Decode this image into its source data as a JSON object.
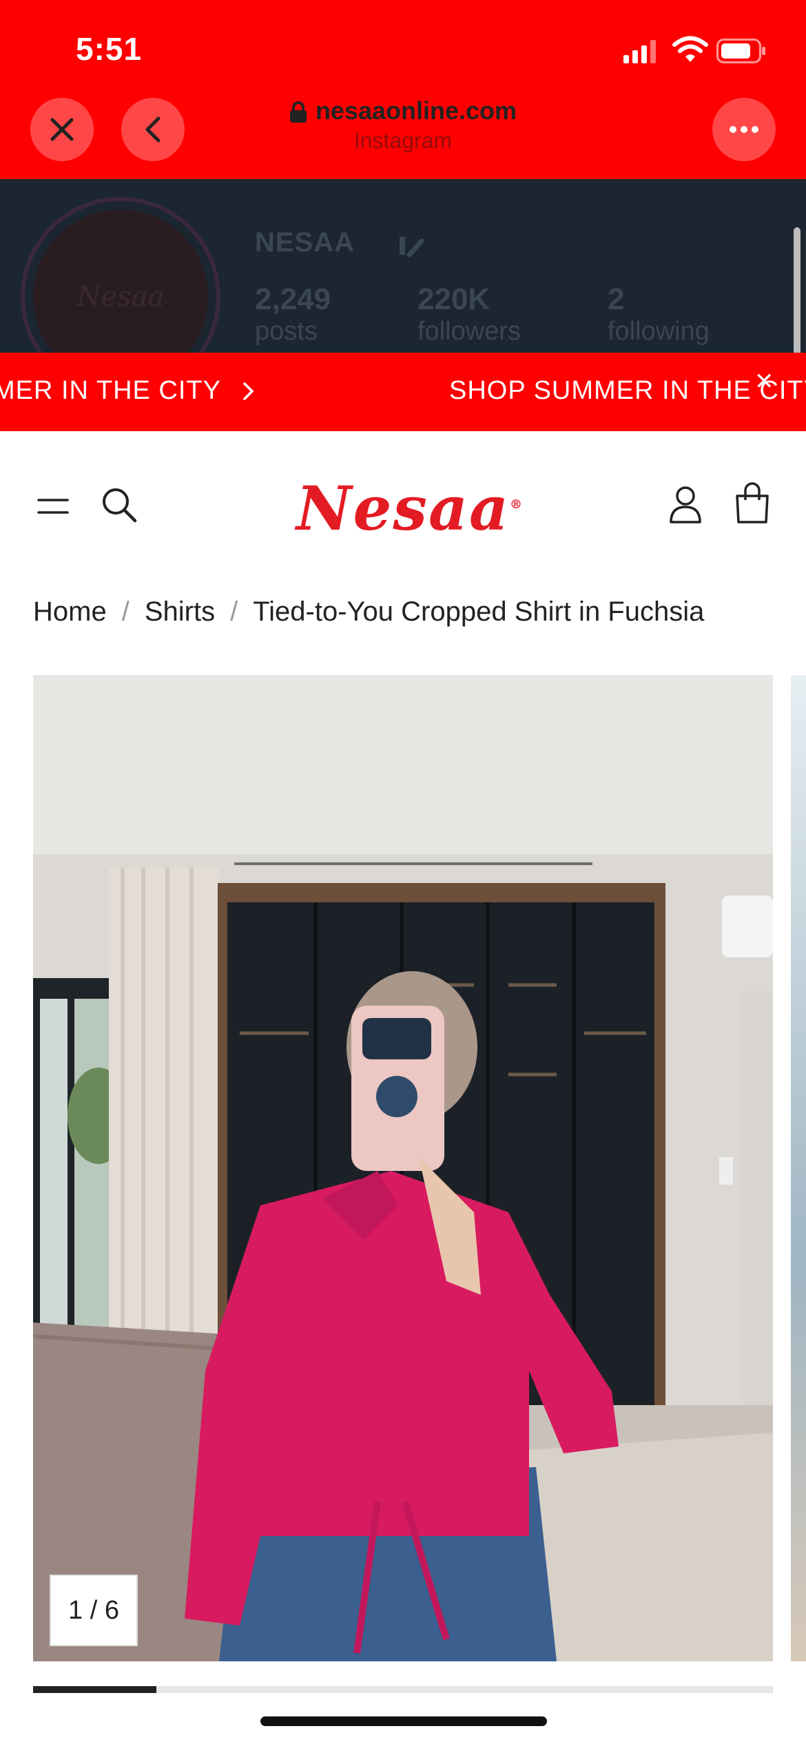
{
  "status_bar": {
    "time": "5:51",
    "icons": [
      "signal-icon",
      "wifi-icon",
      "battery-icon"
    ]
  },
  "browser": {
    "url": "nesaaonline.com",
    "source": "Instagram",
    "buttons": [
      "close-icon",
      "back-icon",
      "more-icon"
    ]
  },
  "instagram_profile": {
    "avatar_text": "Nesaa",
    "name": "NESAA",
    "posts_count": "2,249",
    "posts_label": "posts",
    "followers_count": "220K",
    "followers_label": "followers",
    "following_count": "2",
    "following_label": "following"
  },
  "announcement": {
    "text_left": "MER IN THE CITY",
    "text_right": "SHOP SUMMER IN THE CITY",
    "close": "✕",
    "color": "#ff0000"
  },
  "header": {
    "logo": "Nesaa",
    "logo_mark": "®",
    "logo_color": "#e31b23",
    "icons": [
      "menu-icon",
      "search-icon",
      "account-icon",
      "cart-icon"
    ]
  },
  "breadcrumb": {
    "items": [
      "Home",
      "Shirts",
      "Tied-to-You Cropped Shirt in Fuchsia"
    ],
    "separator": "/"
  },
  "gallery": {
    "counter": "1 / 6",
    "current_index": 1,
    "total": 6,
    "progress_fraction": 0.167,
    "image_description_colors": {
      "shirt": "#d81b60",
      "jeans": "#3b5f8f",
      "wardrobe": "#1d2126"
    }
  }
}
